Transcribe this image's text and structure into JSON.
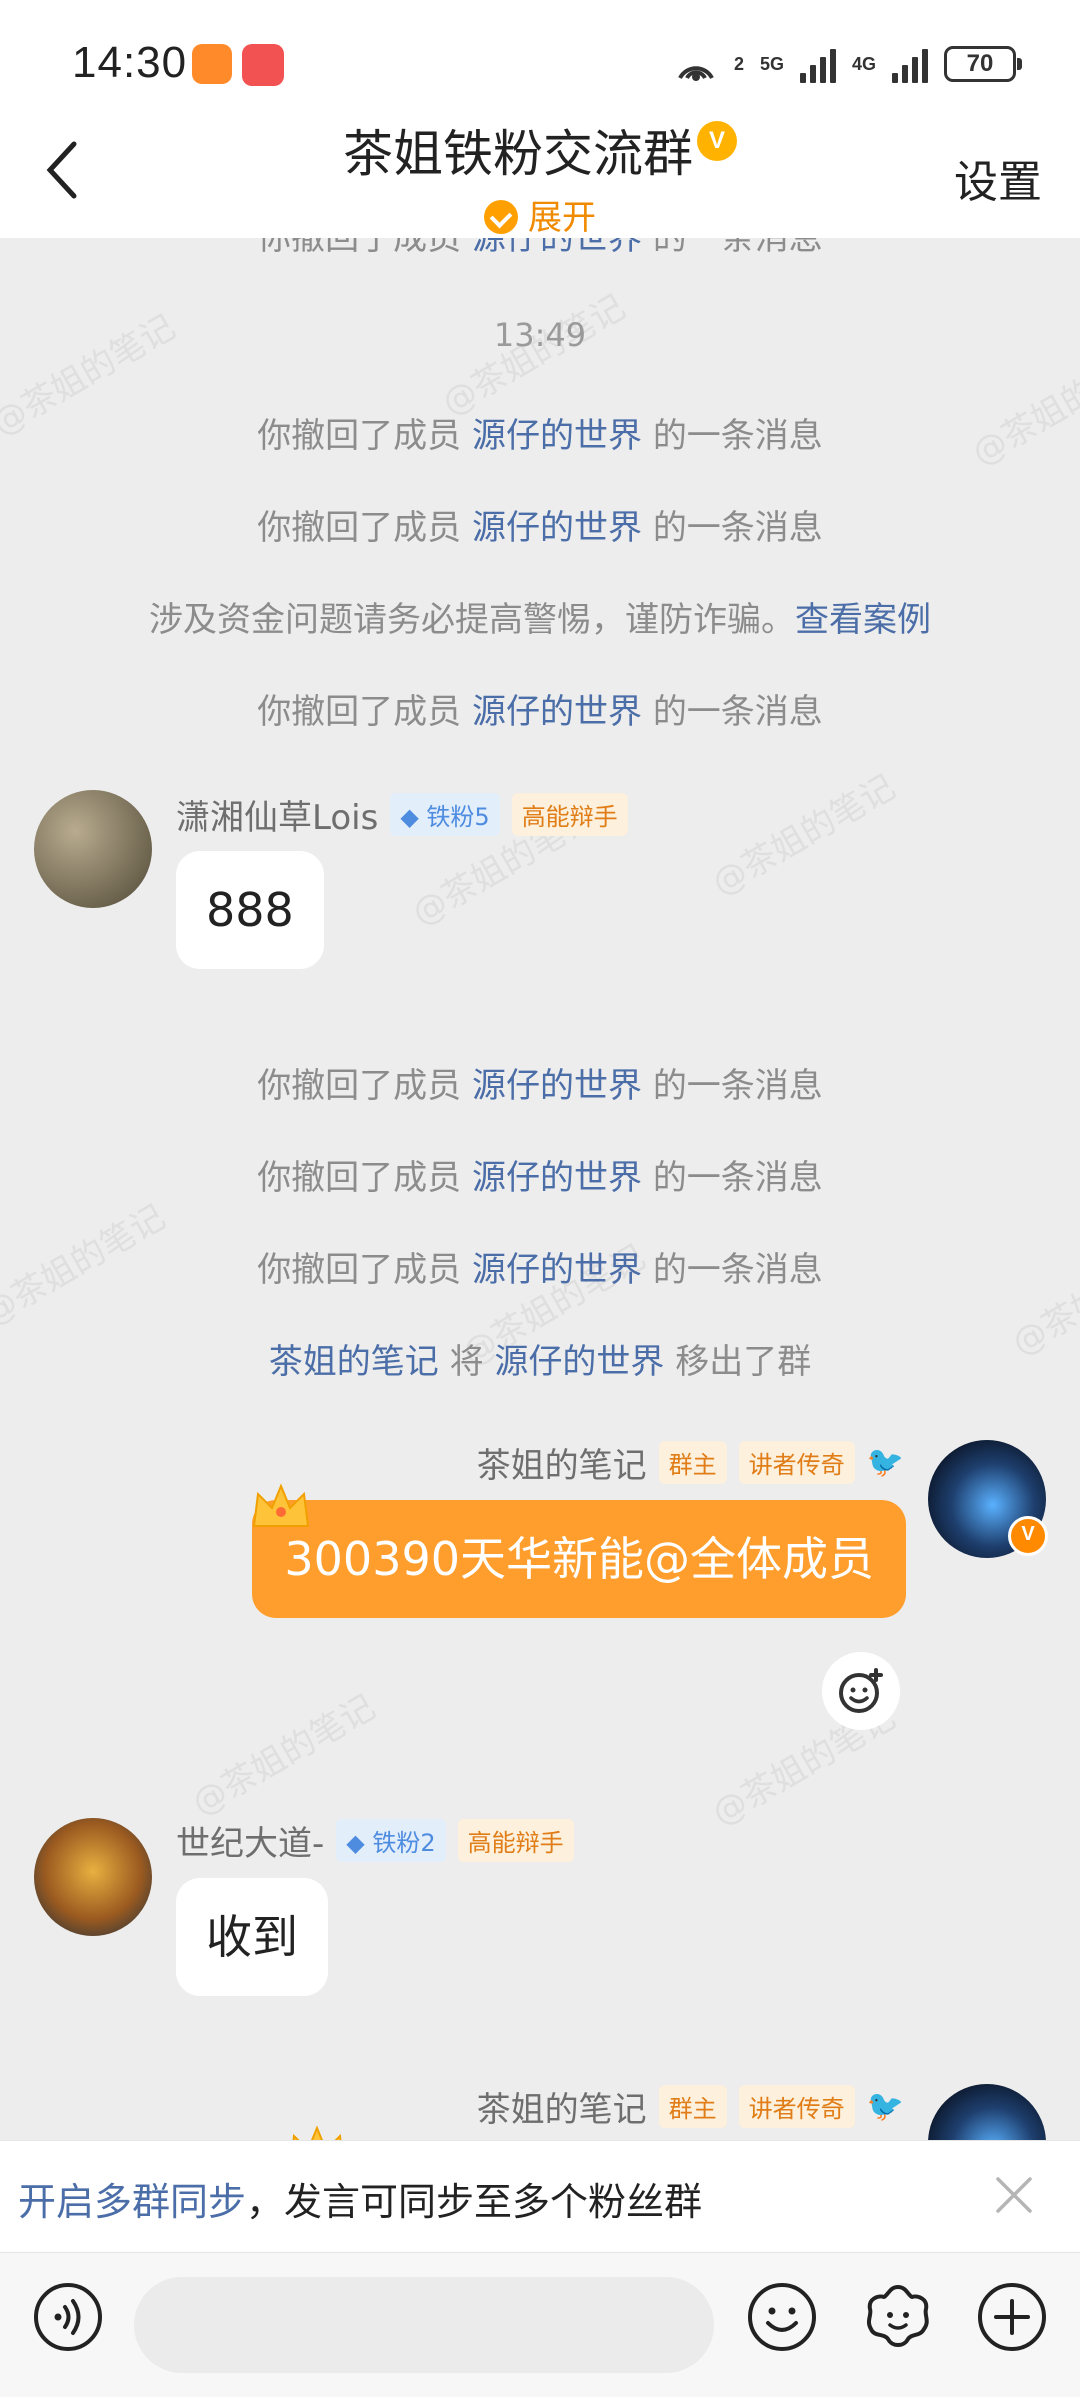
{
  "status_bar": {
    "time": "14:30",
    "battery": "70",
    "net1": "5G",
    "net2": "4G",
    "sim": "2"
  },
  "header": {
    "title": "茶姐铁粉交流群",
    "expand": "展开",
    "settings": "设置"
  },
  "chat": {
    "partial_top": {
      "prefix": "你撤回了成员",
      "member": "源仔的世界",
      "suffix": "的一条消息"
    },
    "timestamp": "13:49",
    "recall_1": {
      "prefix": "你撤回了成员",
      "member": "源仔的世界",
      "suffix": "的一条消息"
    },
    "recall_2": {
      "prefix": "你撤回了成员",
      "member": "源仔的世界",
      "suffix": "的一条消息"
    },
    "warning": {
      "text": "涉及资金问题请务必提高警惕，谨防诈骗。",
      "link": "查看案例"
    },
    "recall_3": {
      "prefix": "你撤回了成员",
      "member": "源仔的世界",
      "suffix": "的一条消息"
    },
    "msg_1": {
      "name": "潇湘仙草Lois",
      "fan_tag": "铁粉5",
      "role_tag": "高能辩手",
      "text": "888"
    },
    "recall_4": {
      "prefix": "你撤回了成员",
      "member": "源仔的世界",
      "suffix": "的一条消息"
    },
    "recall_5": {
      "prefix": "你撤回了成员",
      "member": "源仔的世界",
      "suffix": "的一条消息"
    },
    "recall_6": {
      "prefix": "你撤回了成员",
      "member": "源仔的世界",
      "suffix": "的一条消息"
    },
    "removed": {
      "actor": "茶姐的笔记",
      "verb": "将",
      "target": "源仔的世界",
      "suffix": "移出了群"
    },
    "msg_2": {
      "name": "茶姐的笔记",
      "tag_owner": "群主",
      "tag_role": "讲者传奇",
      "text": "300390天华新能@全体成员"
    },
    "msg_3": {
      "name": "世纪大道-",
      "fan_tag": "铁粉2",
      "role_tag": "高能辩手",
      "text": "收到"
    },
    "msg_4": {
      "name": "茶姐的笔记",
      "tag_owner": "群主",
      "tag_role": "讲者传奇"
    },
    "watermark": "@茶姐的笔记"
  },
  "sync_bar": {
    "link": "开启多群同步",
    "text": "，发言可同步至多个粉丝群"
  },
  "input_bar": {
    "placeholder": ""
  }
}
